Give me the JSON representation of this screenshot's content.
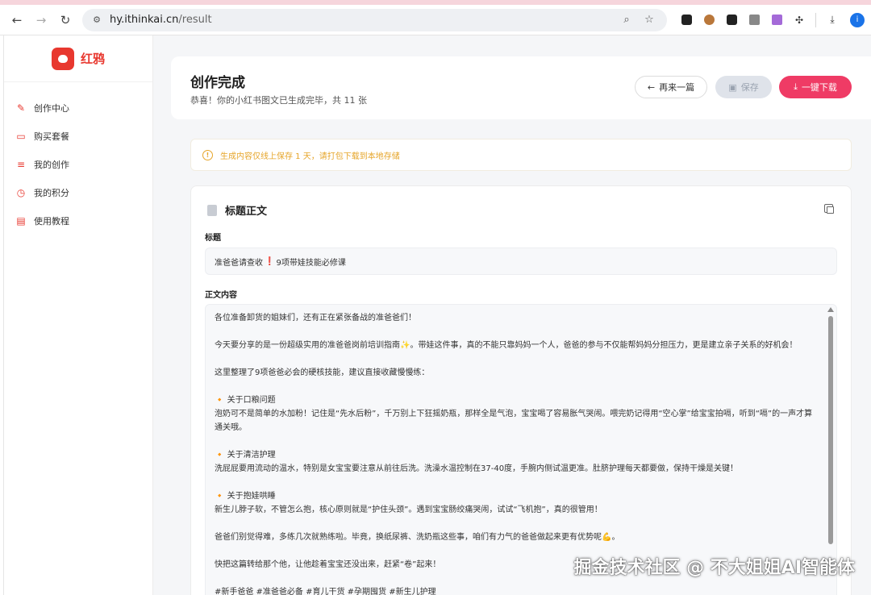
{
  "browser": {
    "url_host": "hy.ithinkai.cn",
    "url_path": "/result",
    "profile_initial": "i"
  },
  "sidebar": {
    "brand_name": "红鸦",
    "items": [
      {
        "label": "创作中心",
        "icon": "pen-icon"
      },
      {
        "label": "购买套餐",
        "icon": "card-icon"
      },
      {
        "label": "我的创作",
        "icon": "list-icon"
      },
      {
        "label": "我的积分",
        "icon": "clock-icon"
      },
      {
        "label": "使用教程",
        "icon": "book-icon"
      }
    ]
  },
  "header": {
    "title": "创作完成",
    "subtitle": "恭喜！你的小红书图文已生成完毕，共 11 张",
    "btn_again": "再来一篇",
    "btn_save": "保存",
    "btn_download": "一键下载"
  },
  "notice": {
    "text": "生成内容仅线上保存 1 天，请打包下载到本地存储"
  },
  "content": {
    "section_title": "标题正文",
    "title_label": "标题",
    "title_before": "准爸爸请查收",
    "title_mark": "❗",
    "title_after": "9项带娃技能必修课",
    "body_label": "正文内容",
    "body_lines": [
      "各位准备卸货的姐妹们，还有正在紧张备战的准爸爸们！",
      "",
      "今天要分享的是一份超级实用的准爸爸岗前培训指南✨。带娃这件事，真的不能只靠妈妈一个人，爸爸的参与不仅能帮妈妈分担压力，更是建立亲子关系的好机会！",
      "",
      "这里整理了9项爸爸必会的硬核技能，建议直接收藏慢慢练：",
      "",
      "🔸 关于口粮问题",
      "泡奶可不是简单的水加粉！记住是“先水后粉”，千万别上下狂摇奶瓶，那样全是气泡，宝宝喝了容易胀气哭闹。喂完奶记得用“空心掌”给宝宝拍嗝，听到“嗝”的一声才算通关哦。",
      "",
      "🔸 关于清洁护理",
      "洗屁屁要用流动的温水，特别是女宝宝要注意从前往后洗。洗澡水温控制在37-40度，手腕内侧试温更准。肚脐护理每天都要做，保持干燥是关键！",
      "",
      "🔸 关于抱娃哄睡",
      "新生儿脖子软，不管怎么抱，核心原则就是“护住头颈”。遇到宝宝肠绞痛哭闹，试试“飞机抱”，真的很管用！",
      "",
      "爸爸们别觉得难，多练几次就熟练啦。毕竟，换纸尿裤、洗奶瓶这些事，咱们有力气的爸爸做起来更有优势呢💪。",
      "",
      "快把这篇转给那个他，让他趁着宝宝还没出来，赶紧“卷”起来！",
      "",
      "#新手爸爸 #准爸爸必备 #育儿干货 #孕期囤货 #新生儿护理"
    ]
  },
  "watermark": "掘金技术社区 @ 不大姐姐AI智能体"
}
